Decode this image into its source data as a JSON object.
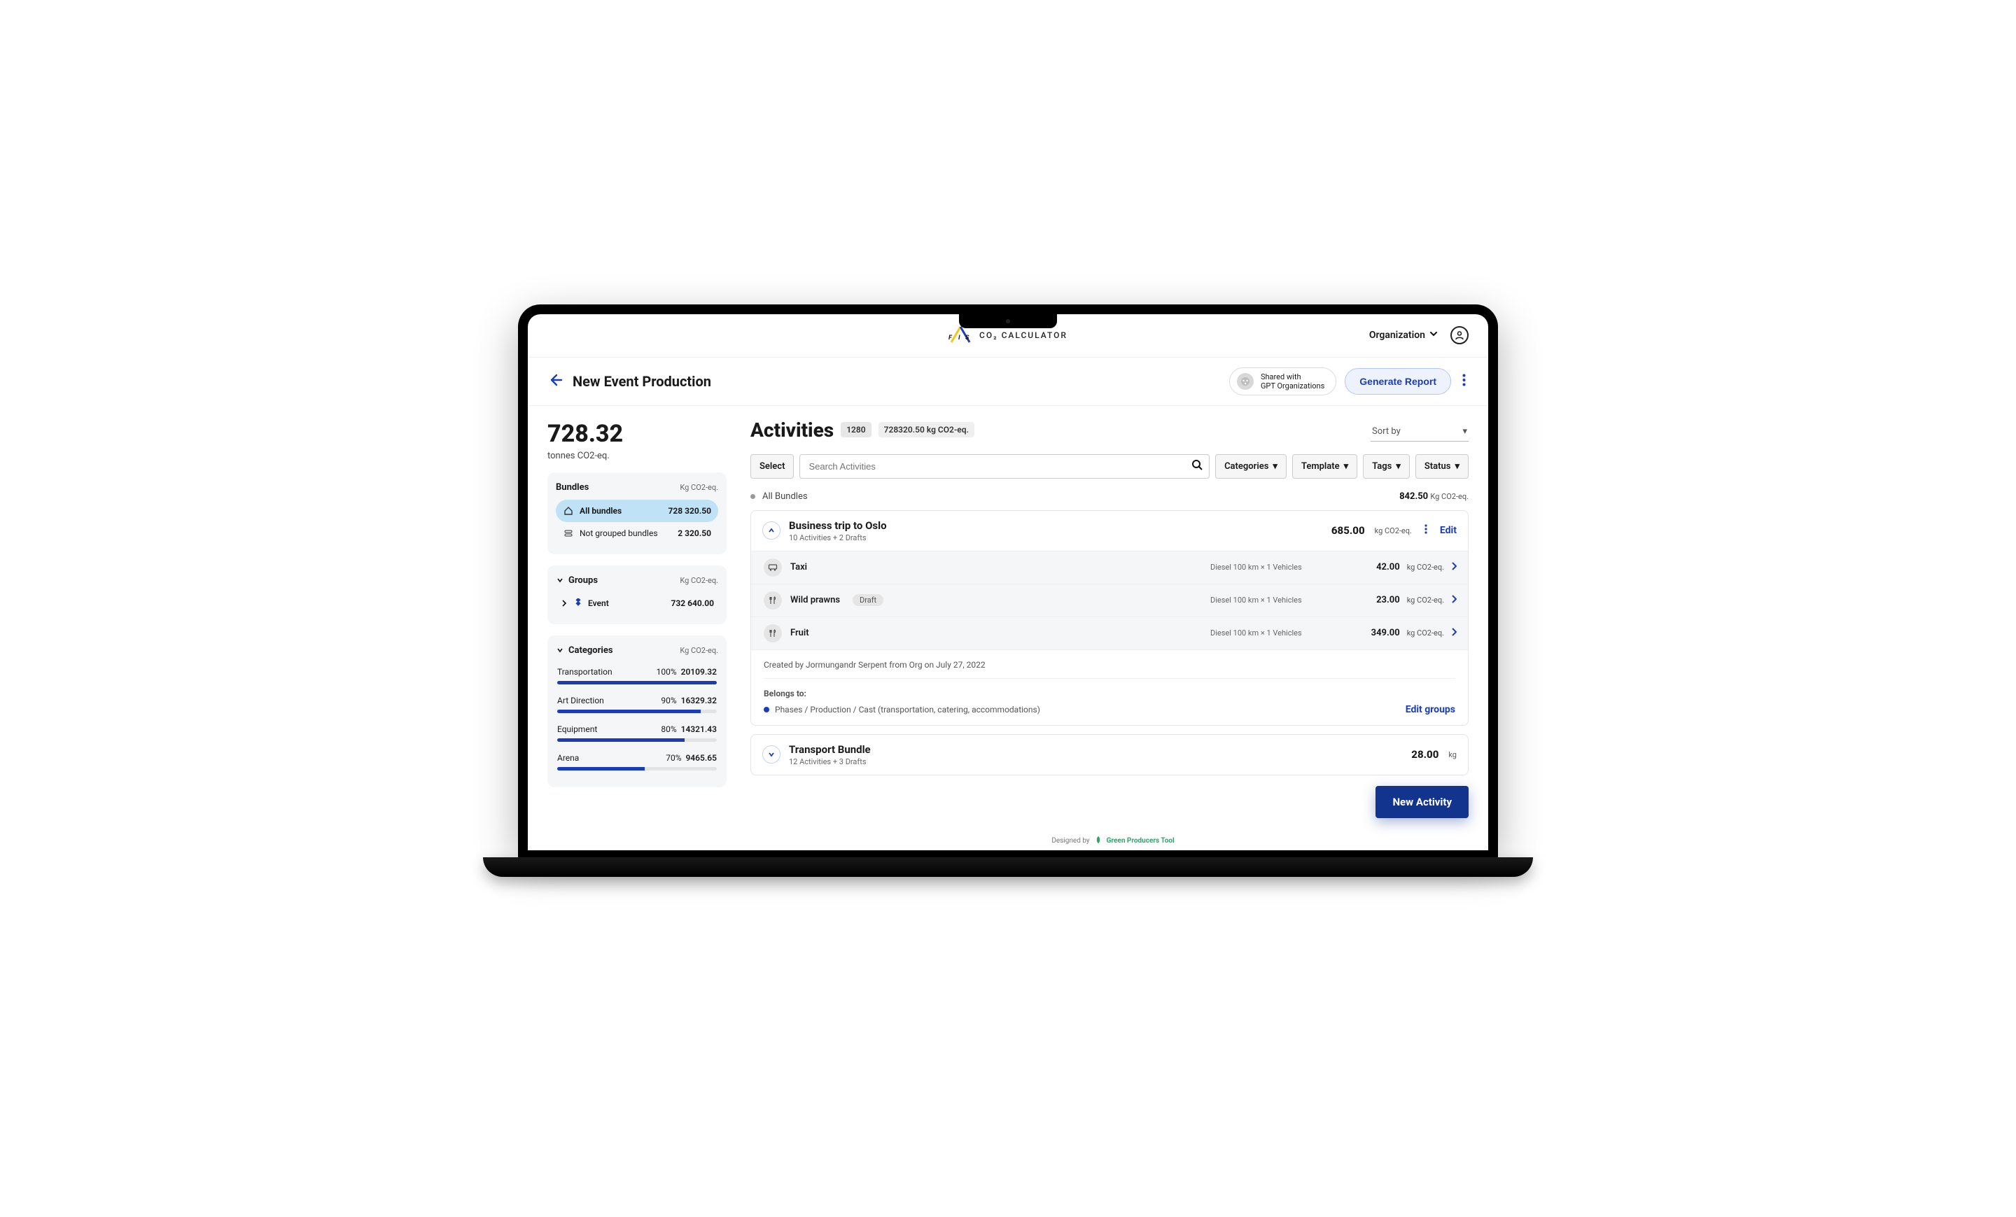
{
  "header": {
    "brand_prefix": "F/I/S",
    "brand_text": "CO₂ CALCULATOR",
    "org_label": "Organization"
  },
  "subheader": {
    "title": "New Event Production",
    "shared_line1": "Shared with",
    "shared_line2": "GPT Organizations",
    "generate_label": "Generate Report"
  },
  "kpi": {
    "value": "728.32",
    "unit": "tonnes CO2-eq."
  },
  "bundles": {
    "title": "Bundles",
    "unit": "Kg CO2-eq.",
    "items": [
      {
        "label": "All bundles",
        "value": "728 320.50",
        "active": true
      },
      {
        "label": "Not grouped bundles",
        "value": "2 320.50",
        "active": false
      }
    ]
  },
  "groups": {
    "title": "Groups",
    "unit": "Kg CO2-eq.",
    "items": [
      {
        "label": "Event",
        "value": "732 640.00"
      }
    ]
  },
  "categories": {
    "title": "Categories",
    "unit": "Kg CO2-eq.",
    "items": [
      {
        "label": "Transportation",
        "pct": "100%",
        "value": "20109.32",
        "bar": 100
      },
      {
        "label": "Art Direction",
        "pct": "90%",
        "value": "16329.32",
        "bar": 90
      },
      {
        "label": "Equipment",
        "pct": "80%",
        "value": "14321.43",
        "bar": 80
      },
      {
        "label": "Arena",
        "pct": "70%",
        "value": "9465.65",
        "bar": 55
      }
    ]
  },
  "main": {
    "title": "Activities",
    "count_badge": "1280",
    "total_badge": "728320.50  kg CO2-eq.",
    "sort_label": "Sort by",
    "filters": {
      "select": "Select",
      "search_placeholder": "Search Activities",
      "categories": "Categories",
      "template": "Template",
      "tags": "Tags",
      "status": "Status"
    },
    "crumb": {
      "label": "All Bundles",
      "value": "842.50",
      "unit": "Kg CO2-eq."
    },
    "bundle1": {
      "title": "Business trip to Oslo",
      "subtitle": "10 Activities + 2 Drafts",
      "value": "685.00",
      "unit": "kg CO2-eq.",
      "edit": "Edit",
      "rows": [
        {
          "icon": "bus",
          "name": "Taxi",
          "draft": "",
          "mid": "Diesel   100 km   × 1 Vehicles",
          "value": "42.00",
          "unit": "kg CO2-eq."
        },
        {
          "icon": "food",
          "name": "Wild prawns",
          "draft": "Draft",
          "mid": "Diesel   100 km   × 1 Vehicles",
          "value": "23.00",
          "unit": "kg CO2-eq."
        },
        {
          "icon": "food",
          "name": "Fruit",
          "draft": "",
          "mid": "Diesel   100 km   × 1 Vehicles",
          "value": "349.00",
          "unit": "kg CO2-eq."
        }
      ],
      "created": "Created by Jormungandr Serpent from Org on July 27, 2022",
      "belongs_label": "Belongs to:",
      "belongs_path": "Phases / Production / Cast (transportation, catering, accommodations)",
      "edit_groups": "Edit groups"
    },
    "bundle2": {
      "title": "Transport Bundle",
      "subtitle": "12 Activities + 3 Drafts",
      "value": "28.00",
      "unit": "kg"
    },
    "fab": "New Activity"
  },
  "footer": {
    "designed": "Designed by",
    "brand": "Green Producers Tool"
  }
}
